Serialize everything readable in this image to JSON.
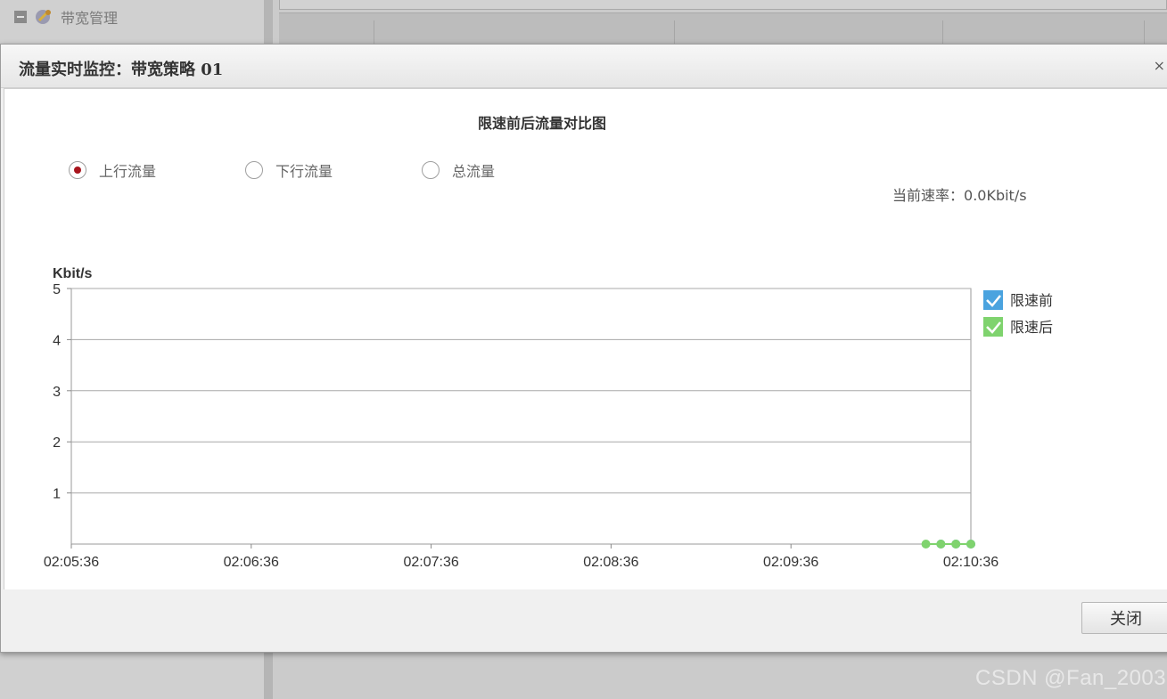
{
  "background": {
    "tree_item_label": "带宽管理"
  },
  "dialog": {
    "title": "流量实时监控：带宽策略 01",
    "close_x": "×",
    "chart_title": "限速前后流量对比图",
    "radios": [
      {
        "label": "上行流量",
        "checked": true
      },
      {
        "label": "下行流量",
        "checked": false
      },
      {
        "label": "总流量",
        "checked": false
      }
    ],
    "current_rate_label": "当前速率：",
    "current_rate_value": "0.0Kbit/s",
    "close_button": "关闭"
  },
  "chart_data": {
    "type": "line",
    "ylabel": "Kbit/s",
    "ylim": [
      0,
      5
    ],
    "y_ticks": [
      "5",
      "4",
      "3",
      "2",
      "1"
    ],
    "x_ticks": [
      "02:05:36",
      "02:06:36",
      "02:07:36",
      "02:08:36",
      "02:09:36",
      "02:10:36"
    ],
    "series": [
      {
        "name": "限速前",
        "color": "#4aa3df",
        "x": [
          "02:10:26",
          "02:10:31",
          "02:10:36"
        ],
        "values": [
          0,
          0,
          0
        ]
      },
      {
        "name": "限速后",
        "color": "#7fd36e",
        "x": [
          "02:10:21",
          "02:10:26",
          "02:10:31",
          "02:10:36"
        ],
        "values": [
          0,
          0,
          0,
          0
        ]
      }
    ],
    "legend": "right",
    "grid": true
  },
  "watermark": "CSDN @Fan_2003"
}
